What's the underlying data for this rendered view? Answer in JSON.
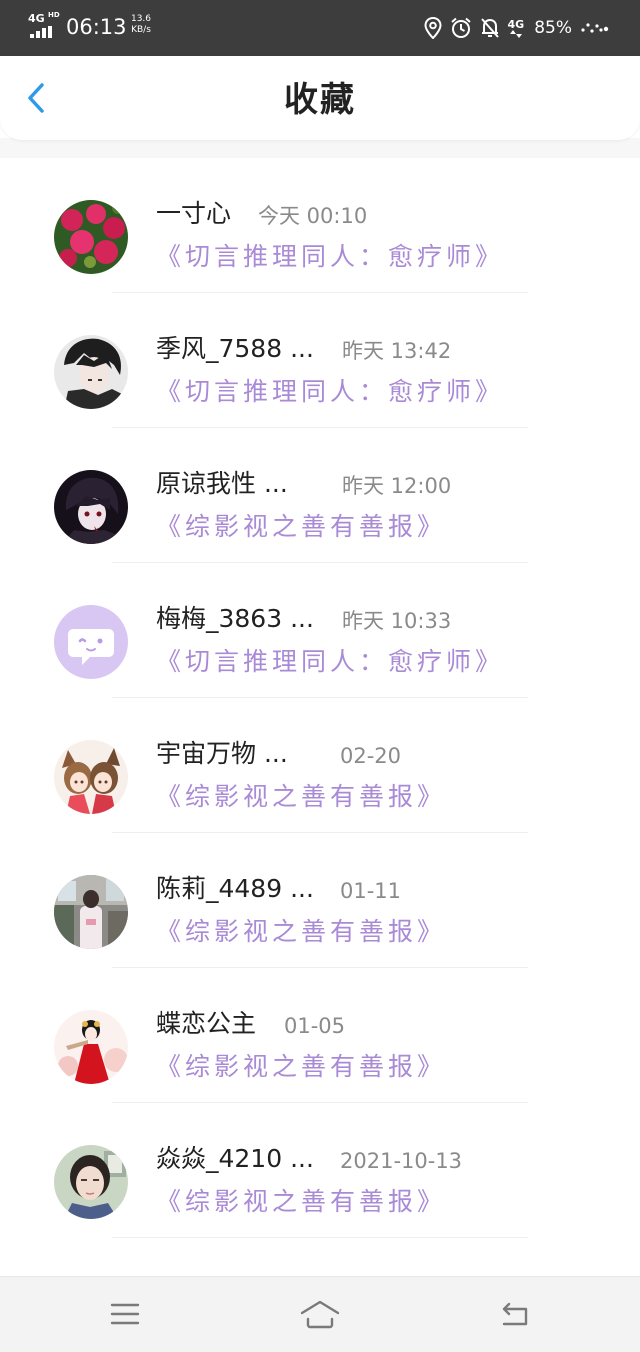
{
  "status_bar": {
    "network": "4G",
    "network_sup": "HD",
    "time": "06:13",
    "speed_value": "13.6",
    "speed_unit": "KB/s",
    "data_4g": "4G",
    "battery": "85%",
    "icons": [
      "location-icon",
      "alarm-icon",
      "mute-notification-icon",
      "signal-4g-icon",
      "dots-icon"
    ]
  },
  "header": {
    "title": "收藏",
    "back_icon": "chevron-left-icon",
    "accent": "#2d9be8"
  },
  "favorites": [
    {
      "user": "一寸心",
      "time": "今天 00:10",
      "book": "《切言推理同人：愈疗师》",
      "avatar": "red-flowers"
    },
    {
      "user": "季风_7588 ...",
      "time": "昨天 13:42",
      "book": "《切言推理同人：愈疗师》",
      "avatar": "anime-boy-dark"
    },
    {
      "user": "原谅我性 ...",
      "time": "昨天 12:00",
      "book": "《综影视之善有善报》",
      "avatar": "anime-dark-red"
    },
    {
      "user": "梅梅_3863 ...",
      "time": "昨天 10:33",
      "book": "《切言推理同人：愈疗师》",
      "avatar": "default-chat-icon"
    },
    {
      "user": "宇宙万物 ...",
      "time": "02-20",
      "book": "《综影视之善有善报》",
      "avatar": "two-anime-girls"
    },
    {
      "user": "陈莉_4489 ...",
      "time": "01-11",
      "book": "《综影视之善有善报》",
      "avatar": "photo-room"
    },
    {
      "user": "蝶恋公主",
      "time": "01-05",
      "book": "《综影视之善有善报》",
      "avatar": "red-dress-girl"
    },
    {
      "user": "焱焱_4210 ...",
      "time": "2021-10-13",
      "book": "《综影视之善有善报》",
      "avatar": "photo-portrait"
    }
  ],
  "colors": {
    "status_bar": "#3d3d3d",
    "book_title": "#a98ad6",
    "time_text": "#8a8a8a",
    "avatar_default": "#d8c6f3"
  },
  "nav_bar": {
    "icons": [
      "menu-icon",
      "home-icon",
      "back-icon"
    ]
  }
}
